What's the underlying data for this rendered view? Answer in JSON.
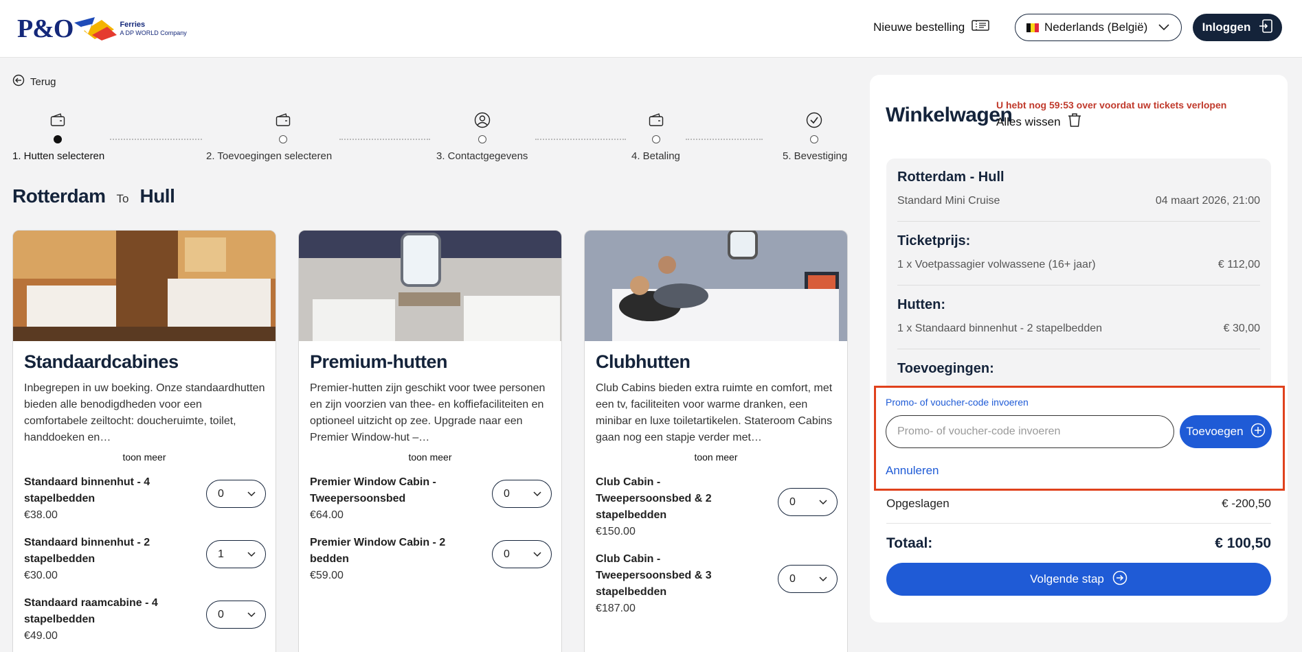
{
  "header": {
    "brand_main": "P&O",
    "brand_line1": "Ferries",
    "brand_line2": "A DP WORLD Company",
    "new_order": "Nieuwe bestelling",
    "language": "Nederlands (België)",
    "login": "Inloggen"
  },
  "back": "Terug",
  "stepper": {
    "steps": [
      {
        "label": "1. Hutten selecteren",
        "icon": "wallet-icon",
        "active": true
      },
      {
        "label": "2. Toevoegingen selecteren",
        "icon": "wallet-icon",
        "active": false
      },
      {
        "label": "3. Contactgegevens",
        "icon": "user-circle-icon",
        "active": false
      },
      {
        "label": "4. Betaling",
        "icon": "wallet-icon",
        "active": false
      },
      {
        "label": "5. Bevestiging",
        "icon": "check-circle-icon",
        "active": false
      }
    ]
  },
  "route": {
    "from": "Rotterdam",
    "to_word": "To",
    "to": "Hull"
  },
  "cards": [
    {
      "title": "Standaardcabines",
      "description": "Inbegrepen in uw boeking. Onze standaardhutten bieden alle benodigdheden voor een comfortabele zeiltocht: doucheruimte, toilet, handdoeken en…",
      "more": "toon meer",
      "options": [
        {
          "name": "Standaard binnenhut - 4 stapelbedden",
          "price": "€38.00",
          "qty": "0"
        },
        {
          "name": "Standaard binnenhut - 2 stapelbedden",
          "price": "€30.00",
          "qty": "1"
        },
        {
          "name": "Standaard raamcabine - 4 stapelbedden",
          "price": "€49.00",
          "qty": "0"
        }
      ]
    },
    {
      "title": "Premium-hutten",
      "description": "Premier-hutten zijn geschikt voor twee personen en zijn voorzien van thee- en koffiefaciliteiten en optioneel uitzicht op zee. Upgrade naar een Premier Window-hut –…",
      "more": "toon meer",
      "options": [
        {
          "name": "Premier Window Cabin - Tweepersoonsbed",
          "price": "€64.00",
          "qty": "0"
        },
        {
          "name": "Premier Window Cabin - 2 bedden",
          "price": "€59.00",
          "qty": "0"
        }
      ]
    },
    {
      "title": "Clubhutten",
      "description": "Club Cabins bieden extra ruimte en comfort, met een tv, faciliteiten voor warme dranken, een minibar en luxe toiletartikelen. Stateroom Cabins gaan nog een stapje verder met…",
      "more": "toon meer",
      "options": [
        {
          "name": "Club Cabin - Tweepersoonsbed & 2 stapelbedden",
          "price": "€150.00",
          "qty": "0"
        },
        {
          "name": "Club Cabin - Tweepersoonsbed & 3 stapelbedden",
          "price": "€187.00",
          "qty": "0"
        }
      ]
    }
  ],
  "cart": {
    "title": "Winkelwagen",
    "timer": "U hebt nog 59:53 over voordat uw tickets verlopen",
    "clear": "Alles wissen",
    "route": "Rotterdam - Hull",
    "product": "Standard Mini Cruise",
    "date": "04 maart 2026, 21:00",
    "ticket_head": "Ticketprijs:",
    "ticket_line": "1 x Voetpassagier volwassene (16+ jaar)",
    "ticket_price": "€ 112,00",
    "cabins_head": "Hutten:",
    "cabin_line": "1 x Standaard binnenhut - 2 stapelbedden",
    "cabin_price": "€ 30,00",
    "extras_head": "Toevoegingen:",
    "promo_label": "Promo- of voucher-code invoeren",
    "promo_placeholder": "Promo- of voucher-code invoeren",
    "promo_add": "Toevoegen",
    "promo_cancel": "Annuleren",
    "saved_label": "Opgeslagen",
    "saved_value": "€ -200,50",
    "total_label": "Totaal:",
    "total_value": "€ 100,50",
    "next": "Volgende stap"
  },
  "colors": {
    "navy": "#14233a",
    "blue": "#1f5bd6",
    "timer_red": "#c0392b",
    "highlight": "#e0411c"
  }
}
